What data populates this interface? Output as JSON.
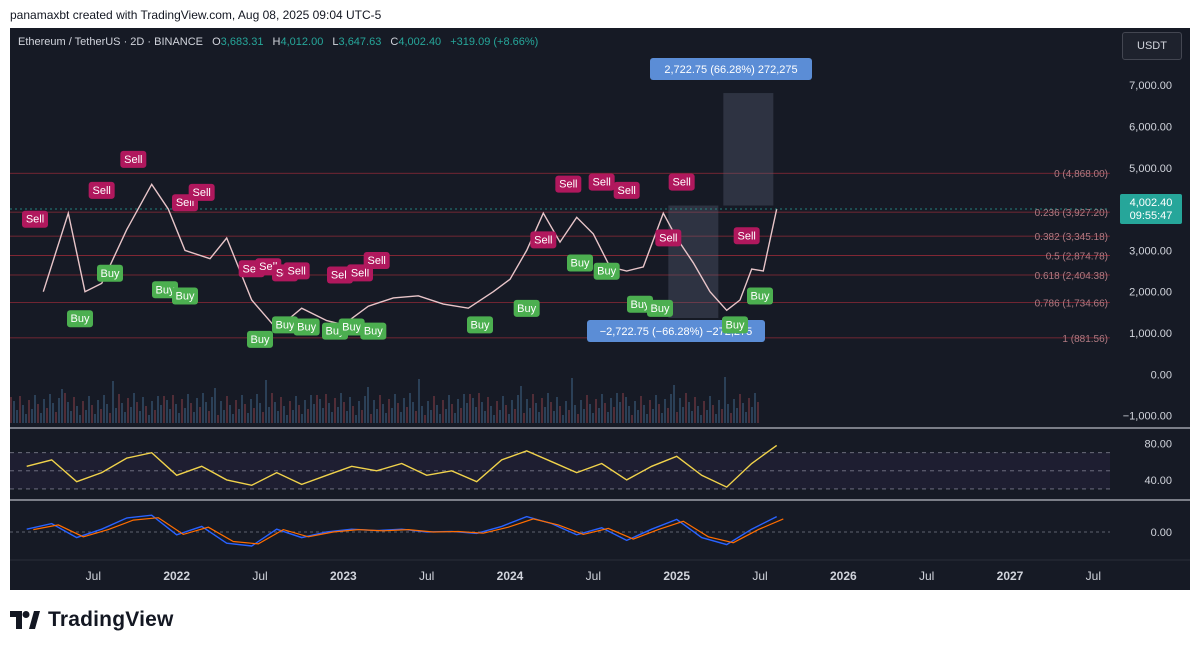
{
  "header": {
    "attribution": "panamaxbt created with TradingView.com, Aug 08, 2025 09:04 UTC-5"
  },
  "symbol": {
    "name": "Ethereum / TetherUS · 2D · BINANCE",
    "open_label": "O",
    "open": "3,683.31",
    "high_label": "H",
    "high": "4,012.00",
    "low_label": "L",
    "low": "3,647.63",
    "close_label": "C",
    "close": "4,002.40",
    "change": "+319.09 (+8.66%)"
  },
  "toolbar": {
    "currency": "USDT"
  },
  "price_tag": {
    "price": "4,002.40",
    "countdown": "09:55:47"
  },
  "measure": {
    "up_label": "2,722.75 (66.28%) 272,275",
    "down_label": "−2,722.75 (−66.28%) −272,275"
  },
  "fib_levels": [
    {
      "label": "0 (4,868.00)",
      "price": 4868
    },
    {
      "label": "0.236 (3,927.20)",
      "price": 3927.2
    },
    {
      "label": "0.382 (3,345.18)",
      "price": 3345.18
    },
    {
      "label": "0.5 (2,874.78)",
      "price": 2874.78
    },
    {
      "label": "0.618 (2,404.38)",
      "price": 2404.38
    },
    {
      "label": "0.786 (1,734.66)",
      "price": 1734.66
    },
    {
      "label": "1 (881.56)",
      "price": 881.56
    }
  ],
  "signals": {
    "buy": "Buy",
    "sell": "Sell"
  },
  "brand": {
    "name": "TradingView"
  },
  "chart_data": [
    {
      "type": "line",
      "name": "price",
      "ylim": [
        -1300,
        7900
      ],
      "y_ticks": [
        "7,000.00",
        "6,000.00",
        "5,000.00",
        "3,000.00",
        "2,000.00",
        "1,000.00",
        "0.00",
        "−1,000.00"
      ],
      "y_tick_values": [
        7000,
        6000,
        5000,
        3000,
        2000,
        1000,
        0,
        -1000
      ],
      "x_ticks": [
        "Jul",
        "2022",
        "Jul",
        "2023",
        "Jul",
        "2024",
        "Jul",
        "2025",
        "Jul",
        "2026",
        "Jul",
        "2027",
        "Jul"
      ],
      "x_tick_values": [
        2021.5,
        2022.0,
        2022.5,
        2023.0,
        2023.5,
        2024.0,
        2024.5,
        2025.0,
        2025.5,
        2026.0,
        2026.5,
        2027.0,
        2027.5
      ],
      "x": [
        2021.2,
        2021.35,
        2021.45,
        2021.55,
        2021.7,
        2021.85,
        2021.95,
        2022.05,
        2022.2,
        2022.3,
        2022.45,
        2022.6,
        2022.75,
        2022.9,
        2023.0,
        2023.15,
        2023.3,
        2023.45,
        2023.6,
        2023.75,
        2023.9,
        2024.0,
        2024.1,
        2024.2,
        2024.3,
        2024.4,
        2024.5,
        2024.6,
        2024.7,
        2024.8,
        2024.92,
        2025.0,
        2025.1,
        2025.2,
        2025.3,
        2025.38,
        2025.45,
        2025.52,
        2025.6
      ],
      "y": [
        2000,
        3900,
        2000,
        2200,
        3500,
        4600,
        4000,
        3000,
        2800,
        3300,
        1800,
        1100,
        1600,
        1300,
        1200,
        1650,
        1850,
        1900,
        1700,
        1600,
        2000,
        2300,
        3000,
        3900,
        3200,
        3800,
        3400,
        2600,
        2500,
        2600,
        3900,
        3300,
        2700,
        2000,
        1550,
        1800,
        2550,
        2500,
        4002
      ],
      "buy_signals": [
        [
          2021.42,
          1600
        ],
        [
          2021.6,
          2700
        ],
        [
          2021.93,
          2300
        ],
        [
          2022.05,
          2150
        ],
        [
          2022.5,
          1100
        ],
        [
          2022.65,
          1450
        ],
        [
          2022.78,
          1400
        ],
        [
          2022.95,
          1300
        ],
        [
          2023.05,
          1400
        ],
        [
          2023.18,
          1300
        ],
        [
          2023.82,
          1450
        ],
        [
          2024.1,
          1850
        ],
        [
          2024.42,
          2950
        ],
        [
          2024.58,
          2750
        ],
        [
          2024.78,
          1950
        ],
        [
          2024.9,
          1850
        ],
        [
          2025.35,
          1450
        ],
        [
          2025.5,
          2150
        ]
      ],
      "sell_signals": [
        [
          2021.15,
          3500
        ],
        [
          2021.55,
          4200
        ],
        [
          2021.74,
          4950
        ],
        [
          2022.05,
          3900
        ],
        [
          2022.15,
          4150
        ],
        [
          2022.45,
          2300
        ],
        [
          2022.55,
          2350
        ],
        [
          2022.65,
          2200
        ],
        [
          2022.72,
          2250
        ],
        [
          2022.98,
          2150
        ],
        [
          2023.1,
          2200
        ],
        [
          2023.2,
          2500
        ],
        [
          2024.2,
          3000
        ],
        [
          2024.35,
          4350
        ],
        [
          2024.55,
          4400
        ],
        [
          2024.7,
          4200
        ],
        [
          2024.95,
          3050
        ],
        [
          2025.03,
          4400
        ],
        [
          2025.42,
          3100
        ]
      ],
      "measure_range": {
        "from": 1363,
        "to": 4086
      }
    },
    {
      "type": "line",
      "name": "RSI",
      "ylim": [
        20,
        95
      ],
      "y_ticks": [
        "80.00",
        "40.00"
      ],
      "y_tick_values": [
        80,
        40
      ],
      "guides": [
        70,
        50,
        30
      ],
      "x": [
        2021.1,
        2021.25,
        2021.4,
        2021.55,
        2021.7,
        2021.85,
        2022.0,
        2022.15,
        2022.3,
        2022.45,
        2022.6,
        2022.75,
        2022.9,
        2023.05,
        2023.2,
        2023.35,
        2023.5,
        2023.65,
        2023.8,
        2023.95,
        2024.1,
        2024.25,
        2024.4,
        2024.55,
        2024.7,
        2024.85,
        2025.0,
        2025.15,
        2025.3,
        2025.45,
        2025.6
      ],
      "y": [
        55,
        62,
        38,
        48,
        64,
        70,
        45,
        55,
        40,
        34,
        48,
        35,
        45,
        55,
        50,
        58,
        45,
        50,
        38,
        62,
        72,
        60,
        48,
        58,
        40,
        55,
        66,
        45,
        32,
        58,
        78
      ]
    },
    {
      "type": "line",
      "name": "MACD",
      "ylim": [
        -1,
        1
      ],
      "y_ticks": [
        "0.00"
      ],
      "y_tick_values": [
        0
      ],
      "x": [
        2021.1,
        2021.25,
        2021.4,
        2021.55,
        2021.7,
        2021.85,
        2022.0,
        2022.15,
        2022.3,
        2022.45,
        2022.6,
        2022.75,
        2022.9,
        2023.05,
        2023.2,
        2023.35,
        2023.5,
        2023.65,
        2023.8,
        2023.95,
        2024.1,
        2024.25,
        2024.4,
        2024.55,
        2024.7,
        2024.85,
        2025.0,
        2025.15,
        2025.3,
        2025.45,
        2025.6
      ],
      "y": [
        0.1,
        0.3,
        -0.2,
        0.1,
        0.5,
        0.6,
        -0.1,
        0.2,
        -0.4,
        -0.5,
        0.1,
        -0.2,
        0.0,
        0.1,
        0.05,
        0.1,
        0.0,
        0.02,
        -0.05,
        0.2,
        0.55,
        0.3,
        -0.1,
        0.15,
        -0.3,
        0.1,
        0.45,
        -0.2,
        -0.45,
        0.1,
        0.55
      ]
    }
  ]
}
